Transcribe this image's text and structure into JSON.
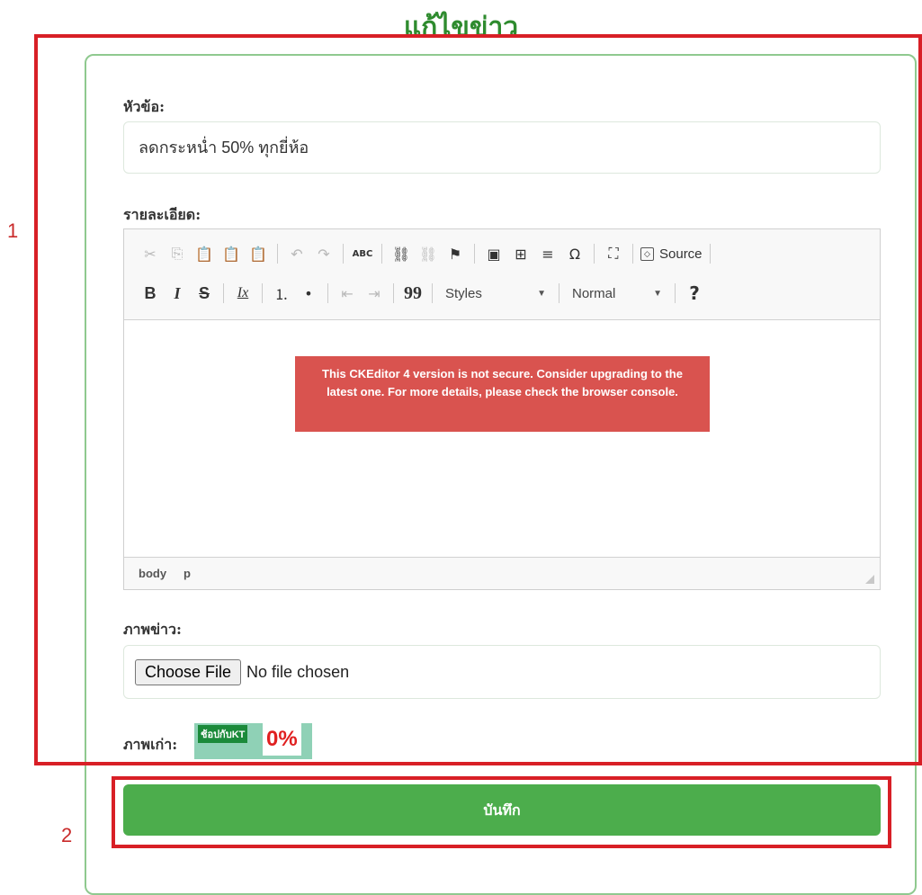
{
  "page_title": "แก้ไขข่าว",
  "form": {
    "title_label": "หัวข้อ:",
    "title_value": "ลดกระหน่ำ 50% ทุกยี่ห้อ",
    "detail_label": "รายละเอียด:",
    "editor": {
      "toolbar_row1": {
        "cut_icon": "✂",
        "copy_icon": "⎘",
        "paste_icon": "📋",
        "paste_text_icon": "📋",
        "paste_word_icon": "📋",
        "undo_icon": "↶",
        "redo_icon": "↷",
        "spellcheck_label": "ABC",
        "link_icon": "⛓",
        "unlink_icon": "⛓",
        "anchor_icon": "⚑",
        "image_icon": "▣",
        "table_icon": "⊞",
        "hr_icon": "≡",
        "special_char_icon": "Ω",
        "maximize_icon": "⛶",
        "source_label": "Source"
      },
      "toolbar_row2": {
        "bold_label": "B",
        "italic_label": "I",
        "strike_label": "S",
        "remove_format_label": "Ix",
        "numbered_list_icon": "⒈",
        "bullet_list_icon": "•",
        "outdent_icon": "⇤",
        "indent_icon": "⇥",
        "blockquote_label": "99",
        "styles_label": "Styles",
        "format_label": "Normal",
        "help_label": "?"
      },
      "warning_text": "This CKEditor 4 version is not secure. Consider upgrading to the latest one. For more details, please check the browser console.",
      "status_body": "body",
      "status_p": "p"
    },
    "image_label": "ภาพข่าว:",
    "choose_file_label": "Choose File",
    "file_status": "No file chosen",
    "old_image_label": "ภาพเก่า:",
    "old_image_text": "ช้อปกับKT",
    "old_image_percent": "0%",
    "save_label": "บันทึก"
  },
  "annotations": {
    "box1_number": "1",
    "box2_number": "2"
  },
  "colors": {
    "title_green": "#2e8b2e",
    "save_button": "#4cad4c",
    "warning_red": "#d9534f",
    "annotation_red": "#d81f26"
  }
}
